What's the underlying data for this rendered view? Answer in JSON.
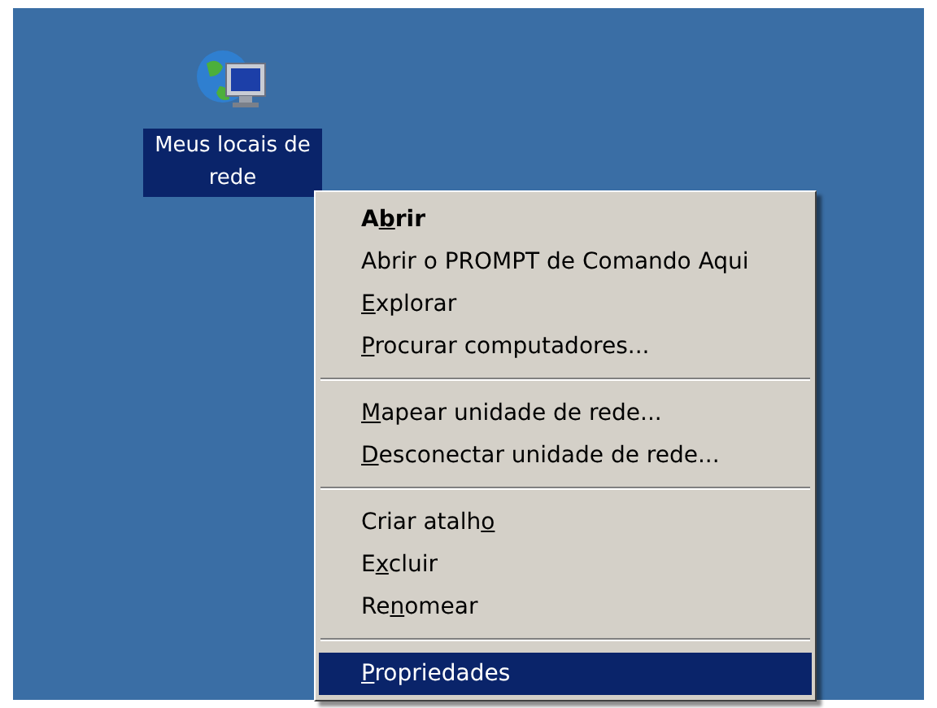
{
  "desktop_icon": {
    "label": "Meus locais de rede",
    "selected": true
  },
  "context_menu": {
    "sections": [
      [
        {
          "pre": "A",
          "key": "b",
          "post": "rir",
          "bold": true,
          "selected": false
        },
        {
          "pre": "Abrir o PROMPT de Comando Aqui",
          "bold": false,
          "selected": false
        },
        {
          "key": "E",
          "post": "xplorar",
          "bold": false,
          "selected": false
        },
        {
          "key": "P",
          "post": "rocurar computadores...",
          "bold": false,
          "selected": false
        }
      ],
      [
        {
          "key": "M",
          "post": "apear unidade de rede...",
          "bold": false,
          "selected": false
        },
        {
          "key": "D",
          "post": "esconectar unidade de rede...",
          "bold": false,
          "selected": false
        }
      ],
      [
        {
          "pre": "Criar atalh",
          "key": "o",
          "bold": false,
          "selected": false
        },
        {
          "pre": "E",
          "key": "x",
          "post": "cluir",
          "bold": false,
          "selected": false
        },
        {
          "pre": "Re",
          "key": "n",
          "post": "omear",
          "bold": false,
          "selected": false
        }
      ],
      [
        {
          "key": "P",
          "post": "ropriedades",
          "bold": false,
          "selected": true
        }
      ]
    ]
  }
}
